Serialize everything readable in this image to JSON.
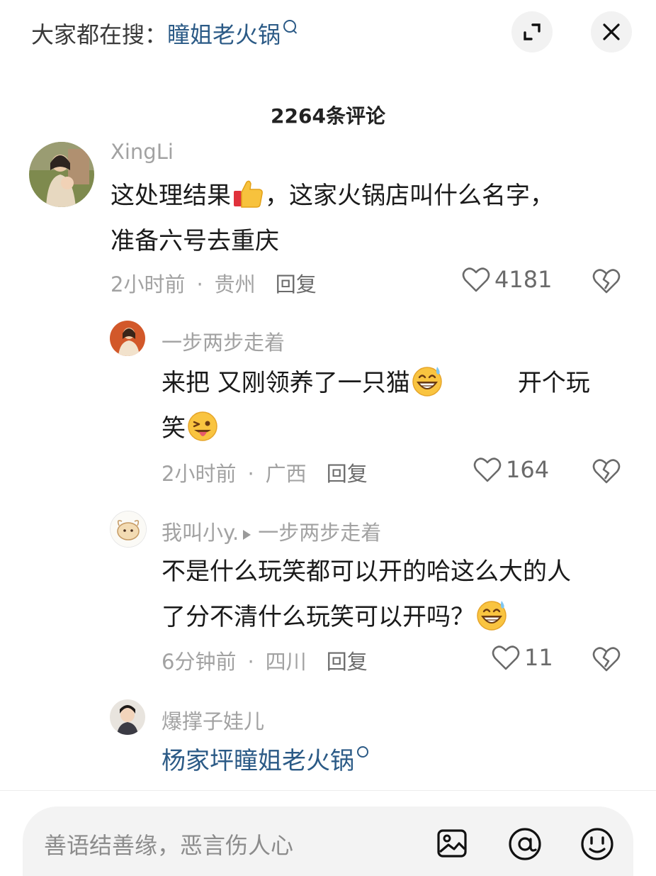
{
  "top": {
    "search_prefix": "大家都在搜：",
    "search_term": "瞳姐老火锅"
  },
  "comment_count": "2264条评论",
  "comments": [
    {
      "user": "XingLi",
      "text_line1": "这处理结果",
      "text_line1_after": "，这家火锅店叫什么名字，",
      "text_line2": "准备六号去重庆",
      "time": "2小时前",
      "region": "贵州",
      "reply": "回复",
      "likes": "4181"
    },
    {
      "user": "一步两步走着",
      "text_line1": "来把  又刚领养了一只猫",
      "text_line1_after": "开个玩",
      "text_line2": "笑",
      "time": "2小时前",
      "region": "广西",
      "reply": "回复",
      "likes": "164"
    },
    {
      "user": "我叫小y.",
      "reply_to": "一步两步走着",
      "text_line1": "不是什么玩笑都可以开的哈这么大的人",
      "text_line2": "了分不清什么玩笑可以开吗？",
      "time": "6分钟前",
      "region": "四川",
      "reply": "回复",
      "likes": "11"
    },
    {
      "user": "爆撑子娃儿",
      "text_line1": "杨家坪瞳姐老火锅"
    }
  ],
  "input": {
    "placeholder": "善语结善缘，恶言伤人心"
  },
  "icons": {
    "expand": "expand-icon",
    "close": "close-icon",
    "like": "heart-icon",
    "dislike": "broken-heart-icon",
    "image": "image-icon",
    "mention": "at-icon",
    "emoji": "emoji-icon"
  },
  "colors": {
    "link": "#2b5a86",
    "meta": "#a2a2a2"
  }
}
